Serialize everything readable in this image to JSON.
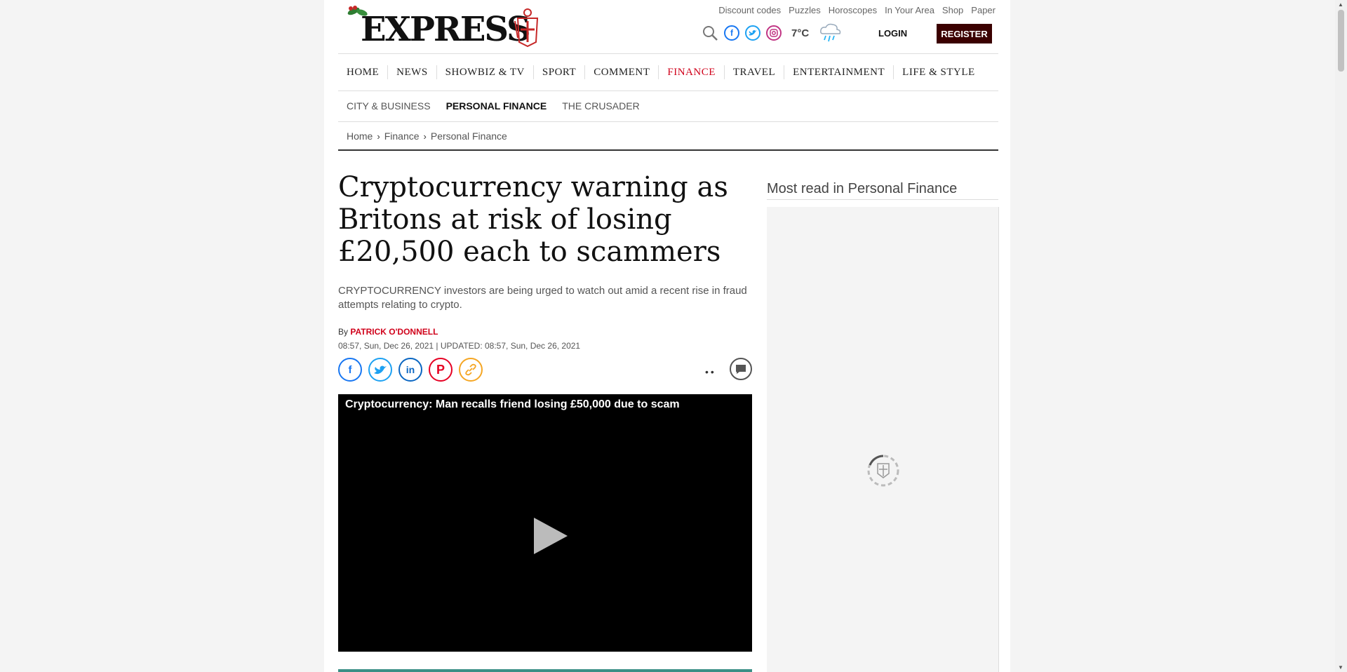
{
  "header": {
    "logo_text": "EXPRESS",
    "utility_links": [
      "Discount codes",
      "Puzzles",
      "Horoscopes",
      "In Your Area",
      "Shop",
      "Paper"
    ],
    "temperature": "7°C",
    "login_label": "LOGIN",
    "register_label": "REGISTER"
  },
  "nav": {
    "items": [
      "HOME",
      "NEWS",
      "SHOWBIZ & TV",
      "SPORT",
      "COMMENT",
      "FINANCE",
      "TRAVEL",
      "ENTERTAINMENT",
      "LIFE & STYLE"
    ],
    "active": "FINANCE"
  },
  "subnav": {
    "items": [
      "CITY & BUSINESS",
      "PERSONAL FINANCE",
      "THE CRUSADER"
    ],
    "active": "PERSONAL FINANCE"
  },
  "breadcrumb": [
    "Home",
    "Finance",
    "Personal Finance"
  ],
  "article": {
    "headline": "Cryptocurrency warning as Britons at risk of losing £20,500 each to scammers",
    "standfirst": "CRYPTOCURRENCY investors are being urged to watch out amid a recent rise in fraud attempts relating to crypto.",
    "by_label": "By",
    "author": "PATRICK O'DONNELL",
    "dates": "08:57, Sun, Dec 26, 2021 | UPDATED: 08:57, Sun, Dec 26, 2021",
    "share_icons": [
      "facebook-icon",
      "twitter-icon",
      "linkedin-icon",
      "pinterest-icon",
      "link-icon"
    ],
    "video_title": "Cryptocurrency: Man recalls friend losing £50,000 due to scam"
  },
  "sidebar": {
    "title": "Most read in Personal Finance"
  },
  "colors": {
    "brand_red": "#d0021b",
    "register_bg": "#3b0000",
    "facebook": "#1877f2",
    "twitter": "#1da1f2",
    "linkedin": "#0a66c2",
    "pinterest": "#e60023",
    "link": "#f5a623"
  }
}
